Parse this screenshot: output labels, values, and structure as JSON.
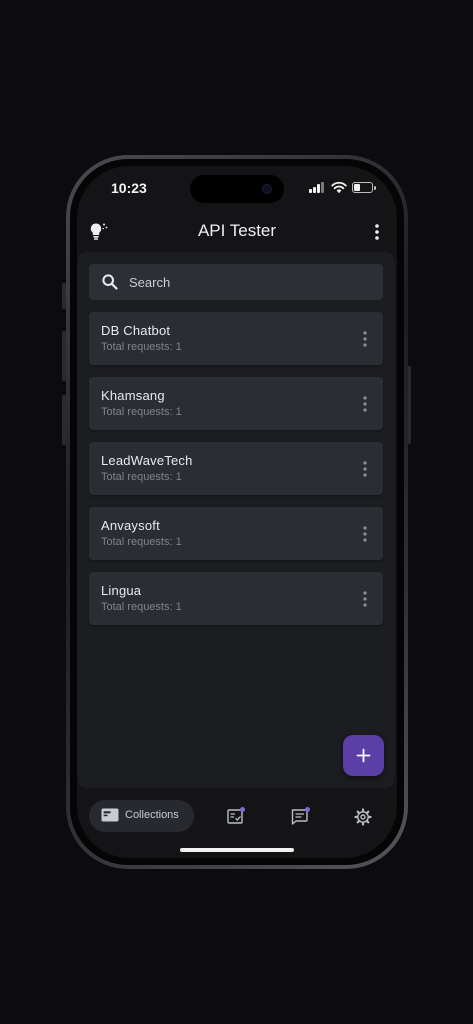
{
  "status_bar": {
    "time": "10:23"
  },
  "app_bar": {
    "title": "API Tester"
  },
  "search": {
    "placeholder": "Search",
    "value": ""
  },
  "collections": [
    {
      "name": "DB Chatbot",
      "subtitle": "Total requests: 1"
    },
    {
      "name": "Khamsang",
      "subtitle": "Total requests: 1"
    },
    {
      "name": "LeadWaveTech",
      "subtitle": "Total requests: 1"
    },
    {
      "name": "Anvaysoft",
      "subtitle": "Total requests: 1"
    },
    {
      "name": "Lingua",
      "subtitle": "Total requests: 1"
    }
  ],
  "fab": {
    "label": "+"
  },
  "bottom_nav": {
    "items": [
      {
        "label": "Collections",
        "icon": "folder-card-icon",
        "active": true
      },
      {
        "label": "",
        "icon": "request-list-icon",
        "active": false
      },
      {
        "label": "",
        "icon": "chat-icon",
        "active": false
      },
      {
        "label": "",
        "icon": "gear-icon",
        "active": false
      }
    ]
  },
  "colors": {
    "background": "#0c0c10",
    "screen": "#141416",
    "panel": "#1c1d21",
    "card": "#2a2d31",
    "accent": "#5b3fa6",
    "badge": "#7b6cd0"
  }
}
